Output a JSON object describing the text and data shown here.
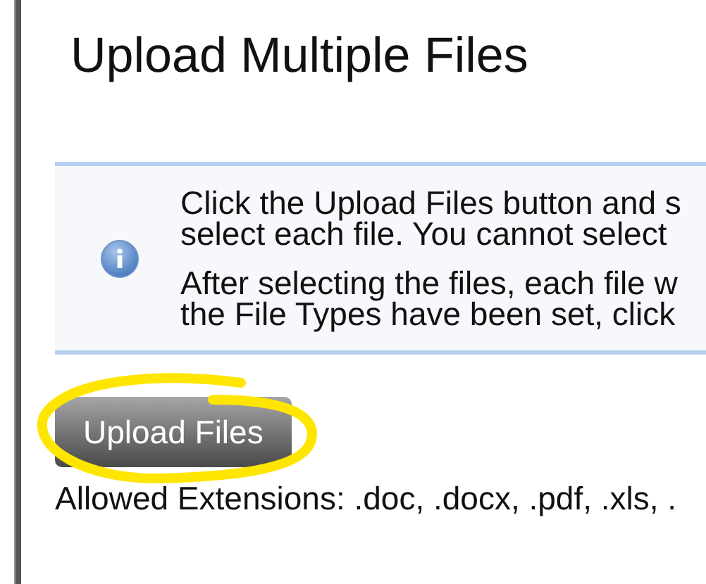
{
  "title": "Upload Multiple Files",
  "info_box": {
    "paragraphs": [
      {
        "lines": [
          "Click the Upload Files button and s",
          "select each file. You cannot select"
        ]
      },
      {
        "lines": [
          "After selecting the files, each file w",
          "the File Types have been set, click"
        ]
      }
    ]
  },
  "upload_button": {
    "label": "Upload Files",
    "circled": true
  },
  "allowed_extensions": "Allowed Extensions: .doc, .docx, .pdf, .xls, ."
}
